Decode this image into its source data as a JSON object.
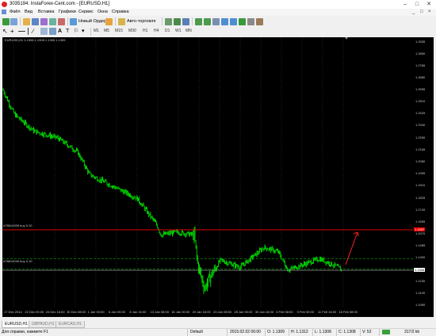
{
  "window": {
    "title": "3035194: InstaForex-Cent.com - [EURUSD,H1]",
    "minimize": "–",
    "maximize": "□",
    "close": "✕"
  },
  "menu": {
    "items": [
      "Файл",
      "Вид",
      "Вставка",
      "Графики",
      "Сервис",
      "Окна",
      "Справка"
    ],
    "mdi_minimize": "_",
    "mdi_restore": "□",
    "mdi_close": "×"
  },
  "toolbar": {
    "new_order_label": "Новый Ордер",
    "autotrading_label": "Авто-торговля",
    "timeframes": [
      "M1",
      "M5",
      "M15",
      "M30",
      "H1",
      "H4",
      "D1",
      "W1",
      "MN"
    ]
  },
  "search": {
    "placeholder": ""
  },
  "chart": {
    "symbol_header": "EURUSD,H1  1.1308 1.1308 1.1305 1.1309",
    "order_line_1": "#78614009 buy 0.10",
    "order_line_2": "#78614049 buy 0.10",
    "colors": {
      "background": "#000000",
      "candles": "#00ff00",
      "resistance_line": "#ff0000",
      "order_line": "#00aa00",
      "bid_line": "#b0b0b0",
      "arrow": "#ff2020"
    },
    "price_ticks": [
      "1.2935",
      "1.2850",
      "1.2765",
      "1.2680",
      "1.2595",
      "1.2510",
      "1.2425",
      "1.2340",
      "1.2250",
      "1.2165",
      "1.2080",
      "1.1995",
      "1.1910",
      "1.1825",
      "1.1740",
      "1.1655",
      "1.1570",
      "1.1485",
      "1.1400",
      "1.1315",
      "1.1230",
      "1.1145",
      "1.1060"
    ],
    "red_line_price": "1.1597",
    "current_price": "1.1308",
    "date_ticks": [
      "17 Dec 2014",
      "22 Dec 00:00",
      "24 Dec 16:00",
      "30 Dec 08:00",
      "1 Jan 00:00",
      "6 Jan 00:00",
      "8 Jan 16:00",
      "13 Jan 08:00",
      "16 Jan 00:00",
      "20 Jan 16:00",
      "23 Jan 08:00",
      "28 Jan 00:00",
      "30 Jan 16:00",
      "4 Feb 08:00",
      "9 Feb 00:00",
      "11 Feb 16:00",
      "16 Feb 08:00"
    ]
  },
  "tabs": [
    "EURUSD,H1",
    "GBPAUD,H1",
    "EURCAD,H1"
  ],
  "status": {
    "help": "Для справки, нажмите F1",
    "profile": "Default",
    "datetime": "2015.02.02 06:00",
    "open": "O: 1.1309",
    "high": "H: 1.1312",
    "low": "L: 1.1308",
    "close": "C: 1.1308",
    "volume": "V: 52",
    "traffic": "317/2 kb"
  }
}
